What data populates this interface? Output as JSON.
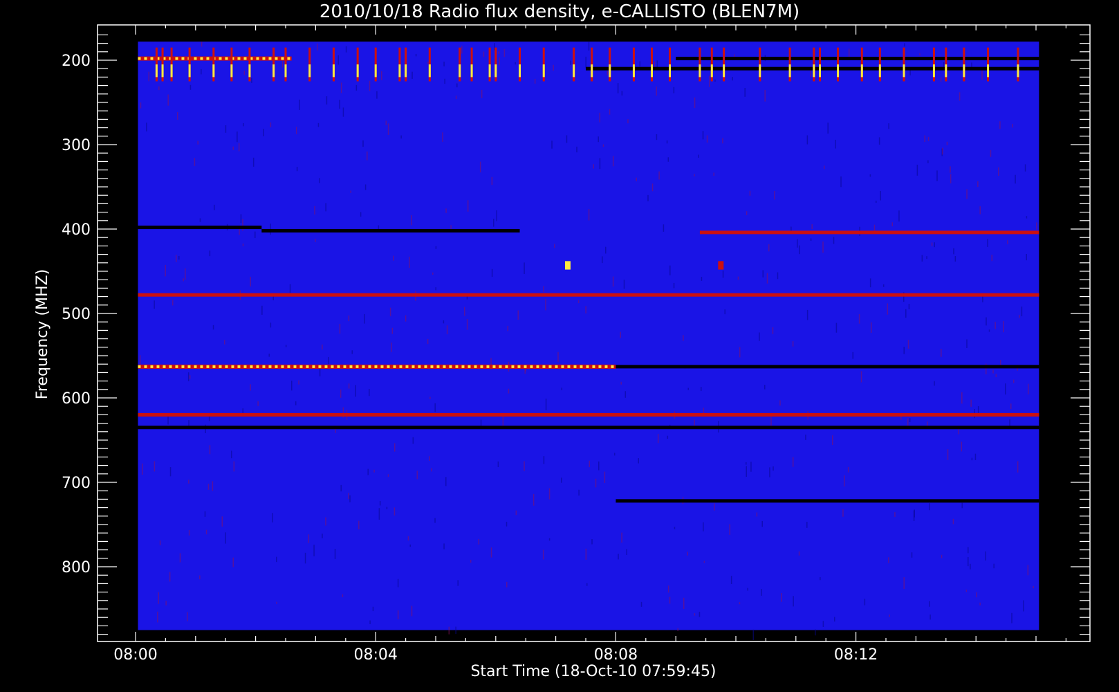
{
  "chart_data": {
    "type": "heatmap",
    "title": "2010/10/18  Radio flux density, e-CALLISTO (BLEN7M)",
    "xlabel": "Start Time (18-Oct-10 07:59:45)",
    "ylabel": "Frequency (MHZ)",
    "x_axis": {
      "unit": "minutes after 08:00",
      "range": [
        0,
        15
      ],
      "ticks": [
        {
          "value": 0,
          "label": "08:00"
        },
        {
          "value": 4,
          "label": "08:04"
        },
        {
          "value": 8,
          "label": "08:08"
        },
        {
          "value": 12,
          "label": "08:12"
        }
      ],
      "data_range": [
        0.04,
        15.05
      ]
    },
    "y_axis": {
      "unit": "MHz",
      "range": [
        160,
        880
      ],
      "inverted": true,
      "ticks": [
        {
          "value": 200,
          "label": "200"
        },
        {
          "value": 300,
          "label": "300"
        },
        {
          "value": 400,
          "label": "400"
        },
        {
          "value": 500,
          "label": "500"
        },
        {
          "value": 600,
          "label": "600"
        },
        {
          "value": 700,
          "label": "700"
        },
        {
          "value": 800,
          "label": "800"
        }
      ],
      "data_range": [
        178,
        875
      ]
    },
    "colors": {
      "background": "#000000",
      "low": "#1a14e6",
      "mid": "#cc1010",
      "high": "#ffea40",
      "absorption": "#000000"
    },
    "features": [
      {
        "kind": "band",
        "freq": 198,
        "start": 0.04,
        "end": 2.6,
        "intensity": "high"
      },
      {
        "kind": "band",
        "freq": 198,
        "start": 9.0,
        "end": 15.05,
        "intensity": "absorption"
      },
      {
        "kind": "band",
        "freq": 210,
        "start": 7.5,
        "end": 15.05,
        "intensity": "absorption"
      },
      {
        "kind": "band",
        "freq": 398,
        "start": 0.04,
        "end": 2.1,
        "intensity": "absorption"
      },
      {
        "kind": "band",
        "freq": 402,
        "start": 2.1,
        "end": 6.4,
        "intensity": "absorption"
      },
      {
        "kind": "band",
        "freq": 404,
        "start": 9.4,
        "end": 15.05,
        "intensity": "mid"
      },
      {
        "kind": "band",
        "freq": 478,
        "start": 0.04,
        "end": 15.05,
        "intensity": "mid"
      },
      {
        "kind": "band",
        "freq": 563,
        "start": 0.04,
        "end": 8.0,
        "intensity": "high"
      },
      {
        "kind": "band",
        "freq": 563,
        "start": 8.0,
        "end": 15.05,
        "intensity": "absorption"
      },
      {
        "kind": "band",
        "freq": 620,
        "start": 0.04,
        "end": 15.05,
        "intensity": "mid"
      },
      {
        "kind": "band",
        "freq": 635,
        "start": 0.04,
        "end": 15.05,
        "intensity": "absorption"
      },
      {
        "kind": "band",
        "freq": 722,
        "start": 8.0,
        "end": 15.05,
        "intensity": "absorption"
      },
      {
        "kind": "bursts",
        "freq_range": [
          185,
          225
        ],
        "times": [
          0.35,
          0.45,
          0.6,
          0.9,
          1.3,
          1.6,
          1.9,
          2.3,
          2.5,
          2.9,
          3.3,
          3.7,
          4.0,
          4.4,
          4.5,
          4.9,
          5.4,
          5.6,
          5.9,
          6.0,
          6.4,
          6.8,
          7.3,
          7.6,
          7.9,
          8.3,
          8.6,
          8.9,
          9.4,
          9.6,
          9.8,
          10.4,
          10.9,
          11.3,
          11.4,
          11.7,
          12.1,
          12.4,
          12.8,
          13.3,
          13.5,
          13.8,
          14.2,
          14.7
        ]
      },
      {
        "kind": "spot",
        "time": 7.2,
        "freq_range": [
          438,
          448
        ],
        "intensity": "high"
      },
      {
        "kind": "spot",
        "time": 9.75,
        "freq_range": [
          438,
          448
        ],
        "intensity": "mid"
      }
    ]
  }
}
